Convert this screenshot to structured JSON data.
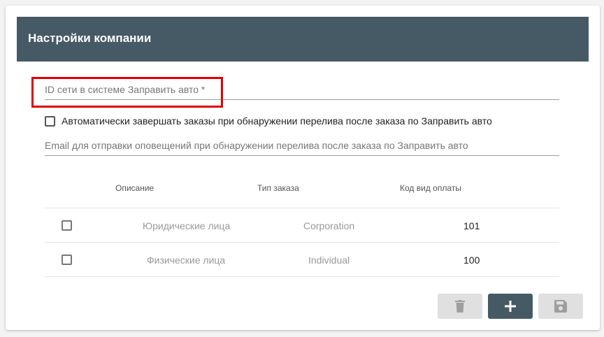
{
  "header": {
    "title": "Настройки компании"
  },
  "form": {
    "network_id_placeholder": "ID сети в системе Заправить авто *",
    "auto_complete_label": "Автоматически завершать заказы при обнаружении перелива после заказа по Заправить авто",
    "email_placeholder": "Email для отправки оповещений при обнаружении перелива после заказа по Заправить авто"
  },
  "table": {
    "columns": [
      "Описание",
      "Тип заказа",
      "Код вид оплаты"
    ],
    "rows": [
      {
        "description": "Юридические лица",
        "order_type": "Corporation",
        "payment_code": "101"
      },
      {
        "description": "Физические лица",
        "order_type": "Individual",
        "payment_code": "100"
      }
    ]
  },
  "colors": {
    "header_bg": "#465a66",
    "highlight": "#e00000",
    "disabled_btn": "#e0e0e0"
  },
  "icons": {
    "delete": "trash-icon",
    "add": "plus-icon",
    "save": "floppy-disk-icon"
  }
}
